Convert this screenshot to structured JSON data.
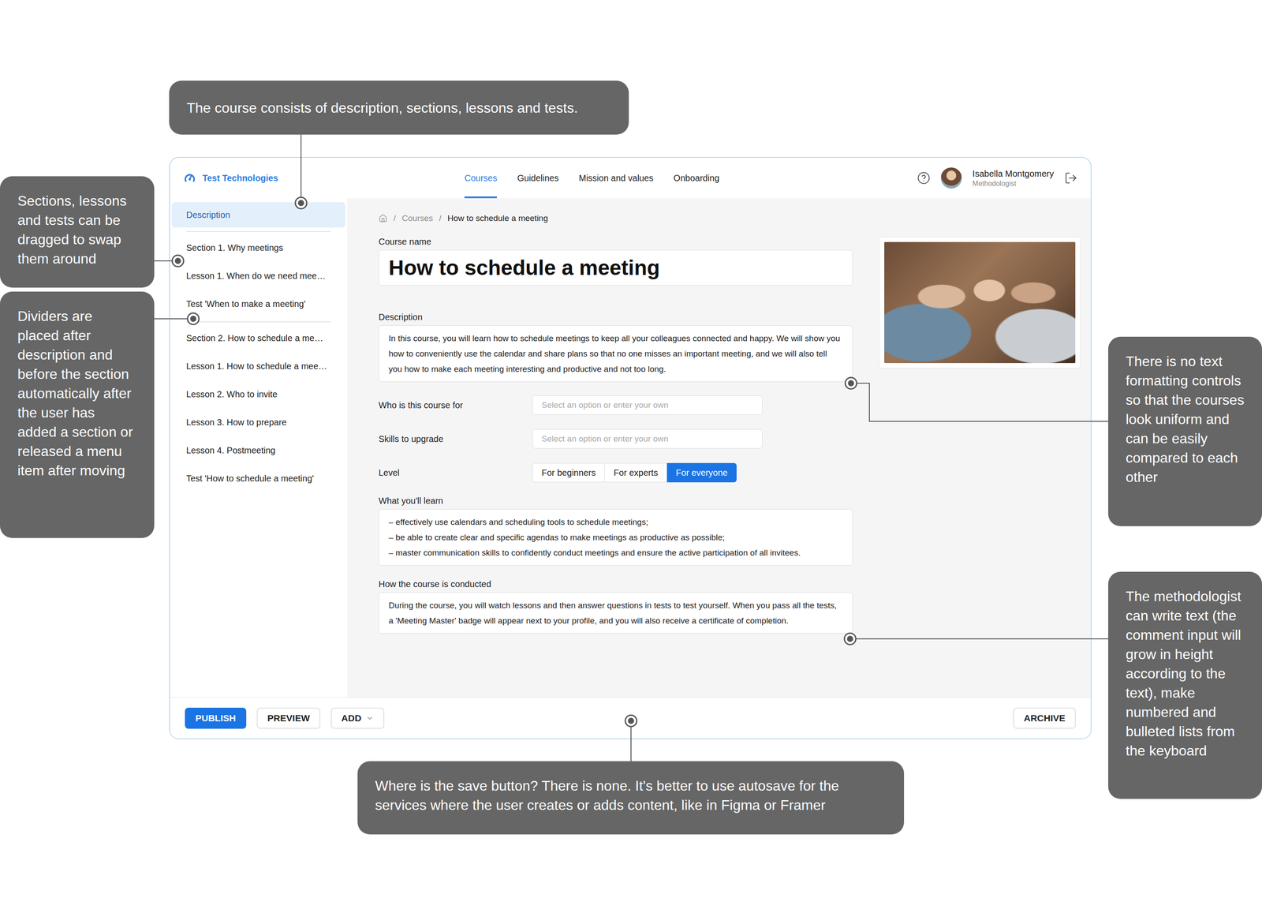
{
  "header": {
    "logo": "Test Technologies",
    "nav": [
      {
        "label": "Courses",
        "selected": true
      },
      {
        "label": "Guidelines",
        "selected": false
      },
      {
        "label": "Mission and values",
        "selected": false
      },
      {
        "label": "Onboarding",
        "selected": false
      }
    ],
    "user": {
      "name": "Isabella Montgomery",
      "role": "Methodologist"
    }
  },
  "sidebar": {
    "items": [
      {
        "kind": "item",
        "label": "Description",
        "selected": true
      },
      {
        "kind": "divider"
      },
      {
        "kind": "item",
        "label": "Section 1. Why meetings",
        "selected": false
      },
      {
        "kind": "item",
        "label": "Lesson 1. When do we need mee…",
        "selected": false
      },
      {
        "kind": "item",
        "label": "Test 'When to make a meeting'",
        "selected": false
      },
      {
        "kind": "divider"
      },
      {
        "kind": "item",
        "label": "Section 2. How to schedule a me…",
        "selected": false
      },
      {
        "kind": "item",
        "label": "Lesson 1. How to schedule a mee…",
        "selected": false
      },
      {
        "kind": "item",
        "label": "Lesson 2. Who to invite",
        "selected": false
      },
      {
        "kind": "item",
        "label": "Lesson 3. How to prepare",
        "selected": false
      },
      {
        "kind": "item",
        "label": "Lesson 4. Postmeeting",
        "selected": false
      },
      {
        "kind": "item",
        "label": "Test 'How to schedule a meeting'",
        "selected": false
      }
    ]
  },
  "breadcrumb": {
    "separator": "/",
    "items": [
      {
        "label": "Courses",
        "current": false
      },
      {
        "label": "How to schedule a meeting",
        "current": true
      }
    ]
  },
  "form": {
    "course_name": {
      "label": "Course name",
      "value": "How to schedule a meeting"
    },
    "description": {
      "label": "Description",
      "value": "In this course, you will learn how to schedule meetings to keep all your colleagues connected and happy. We will show you how to conveniently use the calendar and share plans so that no one misses an important meeting, and we will also tell you how to make each meeting interesting and productive and not too long."
    },
    "selects": [
      {
        "label": "Who is this course for",
        "placeholder": "Select an option or enter your own"
      },
      {
        "label": "Skills to upgrade",
        "placeholder": "Select an option or enter your own"
      }
    ],
    "level": {
      "label": "Level",
      "options": [
        {
          "label": "For beginners",
          "selected": false
        },
        {
          "label": "For experts",
          "selected": false
        },
        {
          "label": "For everyone",
          "selected": true
        }
      ]
    },
    "learn": {
      "label": "What you'll learn",
      "lines": [
        "– effectively use calendars and scheduling tools to schedule meetings;",
        "– be able to create clear and specific agendas to make meetings as productive as possible;",
        "– master communication skills to confidently conduct meetings and ensure the active participation of all invitees."
      ]
    },
    "conducted": {
      "label": "How the course is conducted",
      "value": "During the course, you will watch lessons and then answer questions in tests to test yourself. When you pass all the tests, a 'Meeting Master' badge will appear next to your profile, and you will also receive a certificate of completion."
    }
  },
  "footer": {
    "actions": [
      {
        "label": "PUBLISH",
        "kind": "primary"
      },
      {
        "label": "PREVIEW",
        "kind": "secondary"
      },
      {
        "label": "ADD",
        "kind": "dropdown"
      }
    ],
    "archive": {
      "label": "ARCHIVE"
    }
  },
  "annotations": [
    {
      "text": "The course consists of description, sections, lessons and tests."
    },
    {
      "text": "Sections, lessons and tests can be dragged to swap them around"
    },
    {
      "text": "Dividers are placed after description and before the section automatically after the user has added a section or released a menu item after moving"
    },
    {
      "text": "There is no text formatting controls so that the courses look uniform and can be easily compared to each other"
    },
    {
      "text": "The methodologist can write text (the comment input will grow in height according to the text), make numbered and bulleted lists from the keyboard"
    },
    {
      "text": "Where is the save button? There is none. It's better to use autosave for the services where the user creates or adds content, like in Figma or Framer"
    }
  ]
}
